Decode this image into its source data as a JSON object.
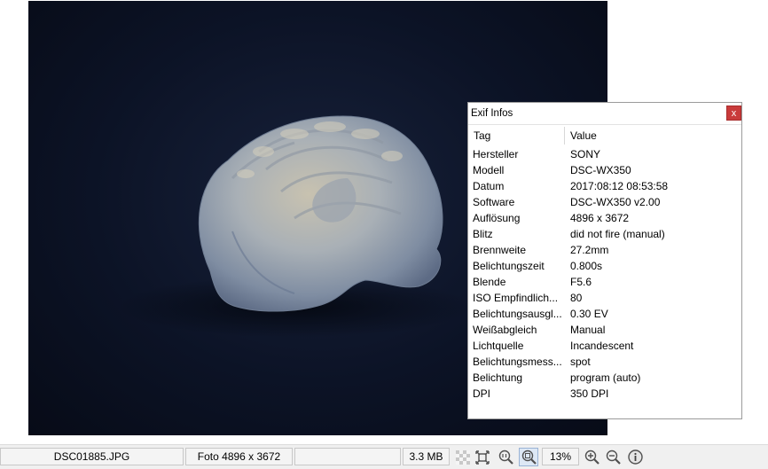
{
  "exif_panel": {
    "title": "Exif Infos",
    "close_label": "x",
    "columns": {
      "tag": "Tag",
      "value": "Value"
    },
    "rows": [
      {
        "tag": "Hersteller",
        "value": "SONY"
      },
      {
        "tag": "Modell",
        "value": "DSC-WX350"
      },
      {
        "tag": "Datum",
        "value": "2017:08:12 08:53:58"
      },
      {
        "tag": "Software",
        "value": "DSC-WX350 v2.00"
      },
      {
        "tag": "Auflösung",
        "value": "4896 x 3672"
      },
      {
        "tag": "Blitz",
        "value": "did not fire (manual)"
      },
      {
        "tag": "Brennweite",
        "value": "27.2mm"
      },
      {
        "tag": "Belichtungszeit",
        "value": "0.800s"
      },
      {
        "tag": "Blende",
        "value": "F5.6"
      },
      {
        "tag": "ISO Empfindlich...",
        "value": "80"
      },
      {
        "tag": "Belichtungsausgl...",
        "value": "0.30 EV"
      },
      {
        "tag": "Weißabgleich",
        "value": "Manual"
      },
      {
        "tag": "Lichtquelle",
        "value": "Incandescent"
      },
      {
        "tag": "Belichtungsmess...",
        "value": "spot"
      },
      {
        "tag": "Belichtung",
        "value": "program (auto)"
      },
      {
        "tag": "DPI",
        "value": "350 DPI"
      }
    ]
  },
  "statusbar": {
    "filename": "DSC01885.JPG",
    "dimensions": "Foto 4896 x 3672",
    "empty_field": "",
    "filesize": "3.3 MB",
    "zoom": "13%",
    "icons": {
      "checker": "transparency-checker-icon",
      "fit": "fit-to-window-icon",
      "actual_size": "actual-size-icon",
      "zoom_fit": "zoom-fit-icon",
      "zoom_in": "zoom-in-icon",
      "zoom_out": "zoom-out-icon",
      "info": "info-icon"
    }
  },
  "colors": {
    "photo_background": "#0c1326",
    "close_button": "#c93b3b",
    "statusbar": "#f0f0f0"
  }
}
